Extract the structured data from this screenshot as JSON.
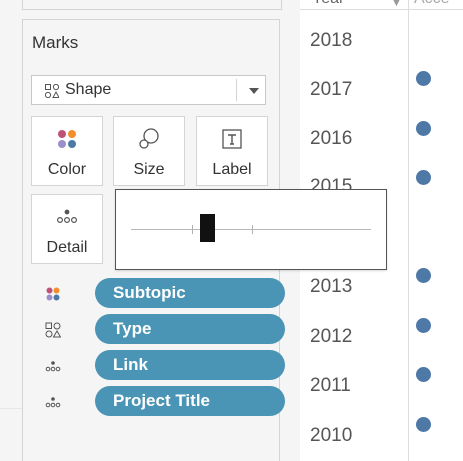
{
  "marks": {
    "title": "Marks",
    "mark_type": {
      "selected": "Shape",
      "icon": "shape-grid-icon"
    },
    "buttons": [
      {
        "label": "Color",
        "icon": "color-dots-icon"
      },
      {
        "label": "Size",
        "icon": "size-circles-icon"
      },
      {
        "label": "Label",
        "icon": "text-label-icon"
      },
      {
        "label": "Detail",
        "icon": "detail-dots-icon"
      }
    ],
    "fields": [
      {
        "label": "Subtopic",
        "icon": "color-dots-icon"
      },
      {
        "label": "Type",
        "icon": "shape-grid-icon"
      },
      {
        "label": "Link",
        "icon": "detail-dots-icon"
      },
      {
        "label": "Project Title",
        "icon": "detail-dots-icon"
      }
    ]
  },
  "size_popup": {
    "slider_value": 0.32
  },
  "view": {
    "header_left": "Year",
    "header_right": "Acce",
    "years": [
      "2018",
      "2017",
      "2016",
      "2015",
      "2013",
      "2012",
      "2011",
      "2010"
    ],
    "dot_color": "#4e79a7",
    "pill_color": "#4a94b5"
  }
}
